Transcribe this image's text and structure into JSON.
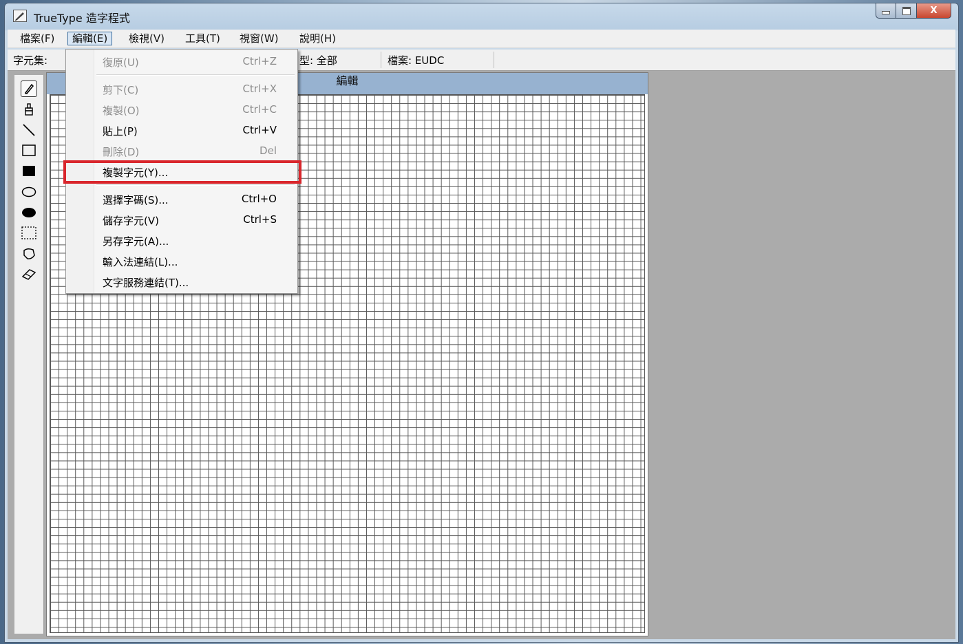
{
  "window": {
    "title": "TrueType 造字程式",
    "close_glyph": "X"
  },
  "menubar": {
    "items": [
      {
        "label": "檔案(F)"
      },
      {
        "label": "編輯(E)"
      },
      {
        "label": "檢視(V)"
      },
      {
        "label": "工具(T)"
      },
      {
        "label": "視窗(W)"
      },
      {
        "label": "說明(H)"
      }
    ],
    "active_index": 1
  },
  "statusbar": {
    "charset_label": "字元集:",
    "type_label": "型: 全部",
    "file_label": "檔案: EUDC"
  },
  "toolbox": {
    "tools": [
      "pencil-icon",
      "brush-icon",
      "line-icon",
      "hollow-rectangle-icon",
      "filled-rectangle-icon",
      "hollow-ellipse-icon",
      "filled-ellipse-icon",
      "rectangular-select-icon",
      "freeform-select-icon",
      "eraser-icon"
    ],
    "selected": "pencil-icon"
  },
  "edit_window": {
    "caption": "編輯"
  },
  "edit_menu": {
    "items": [
      {
        "label": "復原(U)",
        "shortcut": "Ctrl+Z",
        "enabled": false
      },
      {
        "label": "剪下(C)",
        "shortcut": "Ctrl+X",
        "enabled": false
      },
      {
        "label": "複製(O)",
        "shortcut": "Ctrl+C",
        "enabled": false
      },
      {
        "label": "貼上(P)",
        "shortcut": "Ctrl+V",
        "enabled": true
      },
      {
        "label": "刪除(D)",
        "shortcut": "Del",
        "enabled": false
      },
      {
        "label": "複製字元(Y)...",
        "shortcut": "",
        "enabled": true,
        "highlighted": true
      },
      {
        "label": "選擇字碼(S)...",
        "shortcut": "Ctrl+O",
        "enabled": true
      },
      {
        "label": "儲存字元(V)",
        "shortcut": "Ctrl+S",
        "enabled": true
      },
      {
        "label": "另存字元(A)...",
        "shortcut": "",
        "enabled": true
      },
      {
        "label": "輸入法連結(L)...",
        "shortcut": "",
        "enabled": true
      },
      {
        "label": "文字服務連結(T)...",
        "shortcut": "",
        "enabled": true
      }
    ]
  },
  "colors": {
    "highlight_border": "#d9262c",
    "caption_bar": "#97b2d0",
    "workspace": "#ababab"
  }
}
